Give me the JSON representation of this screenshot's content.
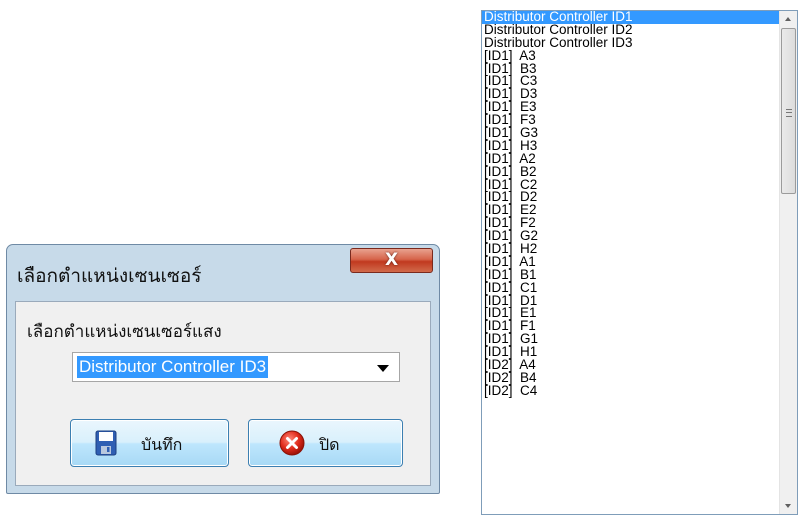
{
  "dialog": {
    "title": "เลือกตำแหน่งเซนเซอร์",
    "close_icon": "close-x-icon",
    "label": "เลือกตำแหน่งเซนเซอร์แสง",
    "combo_value": "Distributor Controller ID3",
    "save_label": "บันทึก",
    "save_icon": "floppy-disk-icon",
    "close_label": "ปิด",
    "close_button_icon": "red-x-circle-icon"
  },
  "dropdown": {
    "selected_index": 0,
    "items": [
      "Distributor Controller ID1",
      "Distributor Controller ID2",
      "Distributor Controller ID3",
      "[ID1]  A3",
      "[ID1]  B3",
      "[ID1]  C3",
      "[ID1]  D3",
      "[ID1]  E3",
      "[ID1]  F3",
      "[ID1]  G3",
      "[ID1]  H3",
      "[ID1]  A2",
      "[ID1]  B2",
      "[ID1]  C2",
      "[ID1]  D2",
      "[ID1]  E2",
      "[ID1]  F2",
      "[ID1]  G2",
      "[ID1]  H2",
      "[ID1]  A1",
      "[ID1]  B1",
      "[ID1]  C1",
      "[ID1]  D1",
      "[ID1]  E1",
      "[ID1]  F1",
      "[ID1]  G1",
      "[ID1]  H1",
      "[ID2]  A4",
      "[ID2]  B4",
      "[ID2]  C4"
    ]
  },
  "colors": {
    "selection": "#3399ff",
    "dialog_frame": "#c7dae9",
    "close_button": "#c1391f"
  }
}
